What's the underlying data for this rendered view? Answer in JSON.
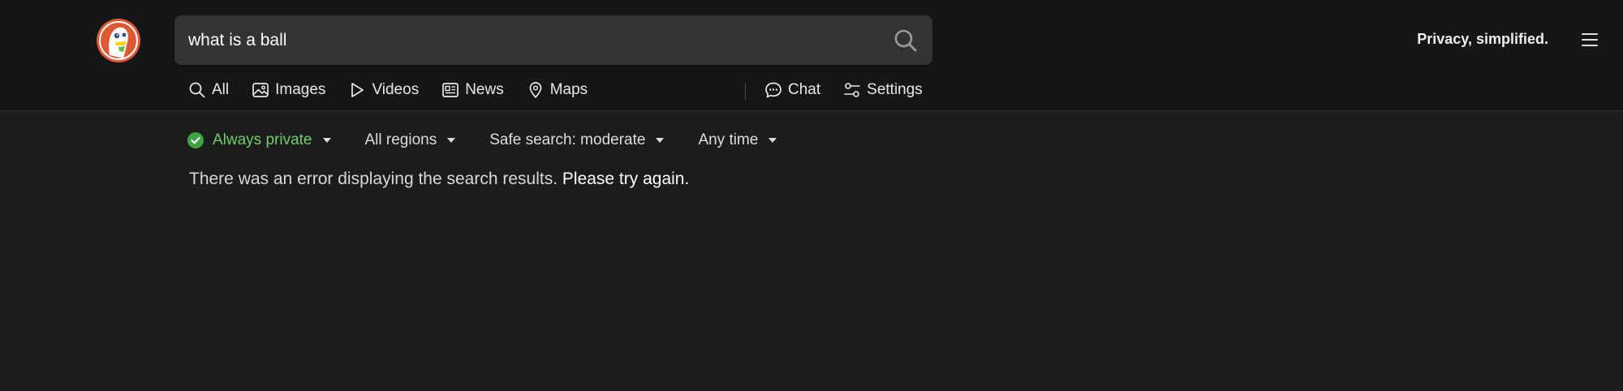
{
  "search": {
    "query": "what is a ball",
    "search_icon": "search-icon"
  },
  "header": {
    "tagline": "Privacy, simplified.",
    "menu_icon": "hamburger-menu-icon",
    "logo": "duckduckgo-logo"
  },
  "nav": {
    "items": [
      {
        "label": "All",
        "icon": "search-icon"
      },
      {
        "label": "Images",
        "icon": "image-icon"
      },
      {
        "label": "Videos",
        "icon": "play-icon"
      },
      {
        "label": "News",
        "icon": "newspaper-icon"
      },
      {
        "label": "Maps",
        "icon": "map-pin-icon"
      }
    ],
    "right_items": [
      {
        "label": "Chat",
        "icon": "chat-bubble-icon"
      },
      {
        "label": "Settings",
        "icon": "settings-sliders-icon"
      }
    ]
  },
  "filters": {
    "private": "Always private",
    "region": "All regions",
    "safe_search": "Safe search: moderate",
    "time": "Any time"
  },
  "message": {
    "error": "There was an error displaying the search results.",
    "retry": "Please try again."
  },
  "colors": {
    "background": "#1c1c1c",
    "header_background": "#161616",
    "search_box": "#333333",
    "private_green": "#6fcf6a",
    "logo_orange": "#de5833"
  }
}
